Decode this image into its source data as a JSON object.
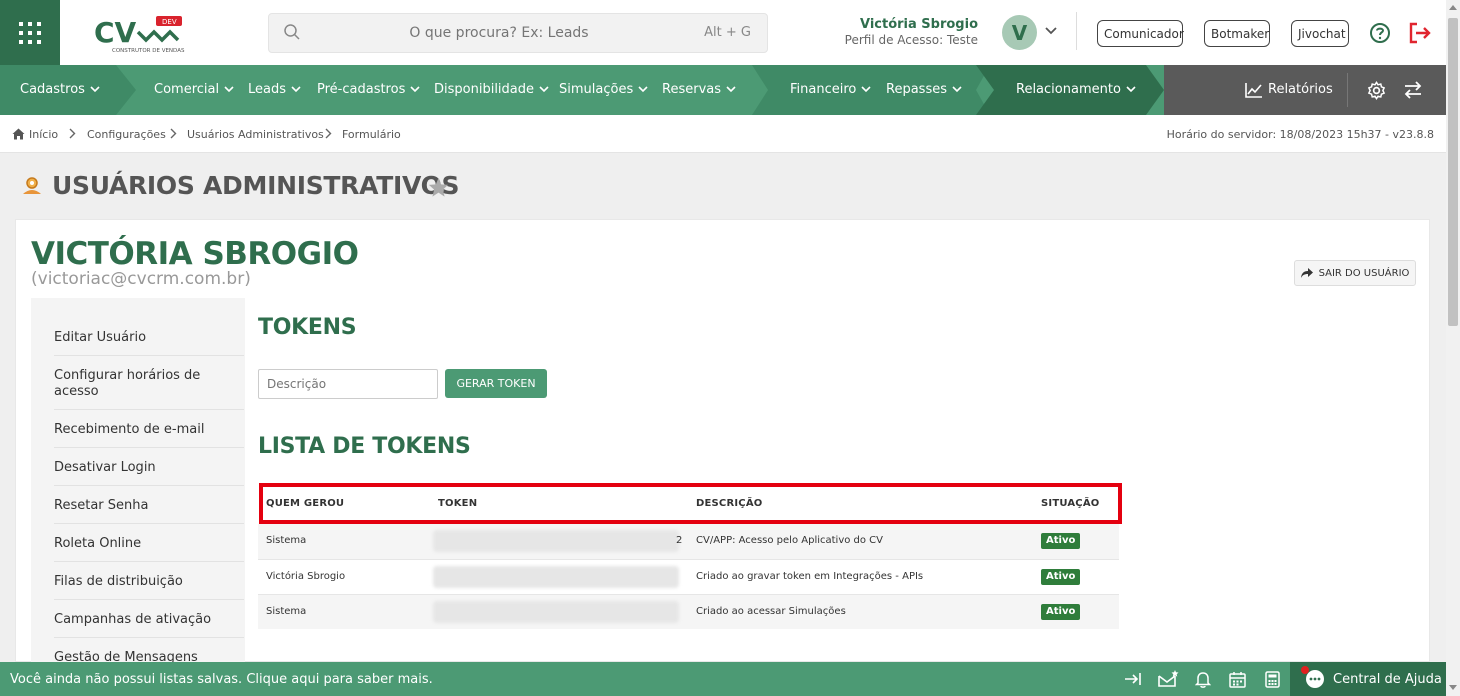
{
  "app": {
    "logo_text": "CV",
    "logo_badge": "DEV",
    "logo_sub": "CONSTRUTOR DE VENDAS"
  },
  "search": {
    "placeholder": "O que procura? Ex: Leads",
    "shortcut": "Alt + G"
  },
  "user": {
    "name": "Victória Sbrogio",
    "profile": "Perfil de Acesso: Teste",
    "initial": "V"
  },
  "header_buttons": [
    "Comunicador",
    "Botmaker",
    "Jivochat"
  ],
  "nav": {
    "items": [
      "Cadastros",
      "Comercial",
      "Leads",
      "Pré-cadastros",
      "Disponibilidade",
      "Simulações",
      "Reservas",
      "Financeiro",
      "Repasses",
      "Relacionamento"
    ],
    "reports": "Relatórios"
  },
  "breadcrumb": [
    "Início",
    "Configurações",
    "Usuários Administrativos",
    "Formulário"
  ],
  "server_time": "Horário do servidor: 18/08/2023 15h37 - v23.8.8",
  "page_title": "USUÁRIOS ADMINISTRATIVOS",
  "profile": {
    "name": "VICTÓRIA SBROGIO",
    "email": "(victoriac@cvcrm.com.br)",
    "exit_label": "SAIR DO USUÁRIO"
  },
  "sidebar": [
    "Editar Usuário",
    "Configurar horários de acesso",
    "Recebimento de e-mail",
    "Desativar Login",
    "Resetar Senha",
    "Roleta Online",
    "Filas de distribuição",
    "Campanhas de ativação",
    "Gestão de Mensagens"
  ],
  "tokens": {
    "title": "TOKENS",
    "input_placeholder": "Descrição",
    "generate_label": "GERAR TOKEN",
    "list_title": "LISTA DE TOKENS"
  },
  "table": {
    "headers": [
      "QUEM GEROU",
      "TOKEN",
      "DESCRIÇÃO",
      "SITUAÇÃO"
    ],
    "rows": [
      {
        "by": "Sistema",
        "token_tail": "2",
        "description": "CV/APP: Acesso pelo Aplicativo do CV",
        "status": "Ativo"
      },
      {
        "by": "Victória Sbrogio",
        "token_tail": "",
        "description": "Criado ao gravar token em Integrações - APIs",
        "status": "Ativo"
      },
      {
        "by": "Sistema",
        "token_tail": "",
        "description": "Criado ao acessar Simulações",
        "status": "Ativo"
      }
    ]
  },
  "footer": {
    "message": "Você ainda não possui listas salvas. Clique aqui para saber mais.",
    "help_center": "Central de Ajuda"
  },
  "colors": {
    "primary": "#4c9a74",
    "dark": "#2f6e4d",
    "highlight": "#e4000f",
    "badge": "#2f7d3b"
  }
}
